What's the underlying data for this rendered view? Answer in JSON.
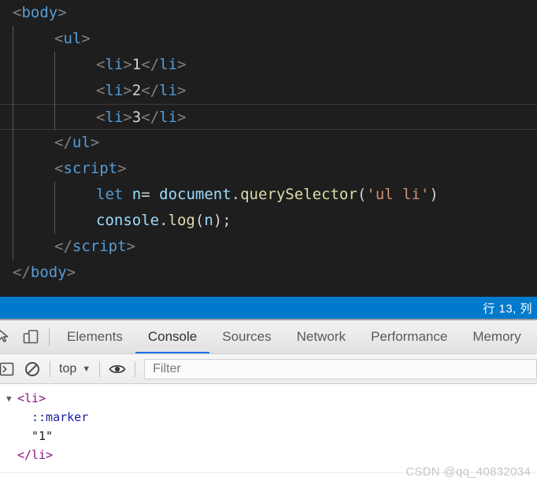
{
  "editor": {
    "theme_background": "#1e1e1e",
    "current_line_index": 4,
    "lines": [
      {
        "indent": 0,
        "segments": [
          {
            "t": "punct",
            "v": "<"
          },
          {
            "t": "tag",
            "v": "body"
          },
          {
            "t": "punct",
            "v": ">"
          }
        ]
      },
      {
        "indent": 1,
        "segments": [
          {
            "t": "punct",
            "v": "<"
          },
          {
            "t": "tag",
            "v": "ul"
          },
          {
            "t": "punct",
            "v": ">"
          }
        ]
      },
      {
        "indent": 2,
        "segments": [
          {
            "t": "punct",
            "v": "<"
          },
          {
            "t": "tag",
            "v": "li"
          },
          {
            "t": "punct",
            "v": ">"
          },
          {
            "t": "text",
            "v": "1"
          },
          {
            "t": "punct",
            "v": "</"
          },
          {
            "t": "tag",
            "v": "li"
          },
          {
            "t": "punct",
            "v": ">"
          }
        ]
      },
      {
        "indent": 2,
        "segments": [
          {
            "t": "punct",
            "v": "<"
          },
          {
            "t": "tag",
            "v": "li"
          },
          {
            "t": "punct",
            "v": ">"
          },
          {
            "t": "text",
            "v": "2"
          },
          {
            "t": "punct",
            "v": "</"
          },
          {
            "t": "tag",
            "v": "li"
          },
          {
            "t": "punct",
            "v": ">"
          }
        ]
      },
      {
        "indent": 2,
        "segments": [
          {
            "t": "punct",
            "v": "<"
          },
          {
            "t": "tag",
            "v": "li"
          },
          {
            "t": "punct",
            "v": ">"
          },
          {
            "t": "text",
            "v": "3"
          },
          {
            "t": "punct",
            "v": "</"
          },
          {
            "t": "tag",
            "v": "li"
          },
          {
            "t": "punct",
            "v": ">"
          }
        ]
      },
      {
        "indent": 1,
        "segments": [
          {
            "t": "punct",
            "v": "</"
          },
          {
            "t": "tag",
            "v": "ul"
          },
          {
            "t": "punct",
            "v": ">"
          }
        ]
      },
      {
        "indent": 1,
        "segments": [
          {
            "t": "punct",
            "v": "<"
          },
          {
            "t": "tag",
            "v": "script"
          },
          {
            "t": "punct",
            "v": ">"
          }
        ]
      },
      {
        "indent": 2,
        "segments": [
          {
            "t": "kw",
            "v": "let"
          },
          {
            "t": "text",
            "v": " "
          },
          {
            "t": "var",
            "v": "n"
          },
          {
            "t": "paren",
            "v": "= "
          },
          {
            "t": "var",
            "v": "document"
          },
          {
            "t": "paren",
            "v": "."
          },
          {
            "t": "fn",
            "v": "querySelector"
          },
          {
            "t": "paren",
            "v": "("
          },
          {
            "t": "str",
            "v": "'ul li'"
          },
          {
            "t": "paren",
            "v": ")"
          }
        ]
      },
      {
        "indent": 2,
        "segments": [
          {
            "t": "var",
            "v": "console"
          },
          {
            "t": "paren",
            "v": "."
          },
          {
            "t": "fn",
            "v": "log"
          },
          {
            "t": "paren",
            "v": "("
          },
          {
            "t": "var",
            "v": "n"
          },
          {
            "t": "paren",
            "v": ");"
          }
        ]
      },
      {
        "indent": 1,
        "segments": [
          {
            "t": "punct",
            "v": "</"
          },
          {
            "t": "tag",
            "v": "script"
          },
          {
            "t": "punct",
            "v": ">"
          }
        ]
      },
      {
        "indent": 0,
        "segments": [
          {
            "t": "punct",
            "v": "</"
          },
          {
            "t": "tag",
            "v": "body"
          },
          {
            "t": "punct",
            "v": ">"
          }
        ]
      }
    ]
  },
  "statusbar": {
    "background": "#007acc",
    "position_label": "行 13, 列"
  },
  "devtools": {
    "inspect_icon": "inspect-cursor-icon",
    "device_icon": "device-toolbar-icon",
    "tabs": [
      {
        "label": "Elements",
        "active": false
      },
      {
        "label": "Console",
        "active": true
      },
      {
        "label": "Sources",
        "active": false
      },
      {
        "label": "Network",
        "active": false
      },
      {
        "label": "Performance",
        "active": false
      },
      {
        "label": "Memory",
        "active": false
      }
    ],
    "active_tab_accent": "#1a73e8",
    "console_toolbar": {
      "sidebar_icon": "console-sidebar-icon",
      "clear_icon": "clear-console-icon",
      "context_value": "top",
      "context_caret": "▼",
      "eye_icon": "live-expression-eye-icon",
      "filter_placeholder": "Filter",
      "filter_value": ""
    },
    "console_output": {
      "rows": [
        {
          "indent": 0,
          "expanded": true,
          "segments": [
            {
              "t": "tag",
              "v": "<li>"
            }
          ]
        },
        {
          "indent": 1,
          "expanded": null,
          "segments": [
            {
              "t": "pseudo",
              "v": "::marker"
            }
          ]
        },
        {
          "indent": 1,
          "expanded": null,
          "segments": [
            {
              "t": "textnode",
              "v": "\"1\""
            }
          ]
        },
        {
          "indent": 0,
          "expanded": null,
          "segments": [
            {
              "t": "tag",
              "v": "</li>"
            }
          ]
        }
      ]
    }
  },
  "watermark": {
    "text": "CSDN @qq_40832034"
  }
}
